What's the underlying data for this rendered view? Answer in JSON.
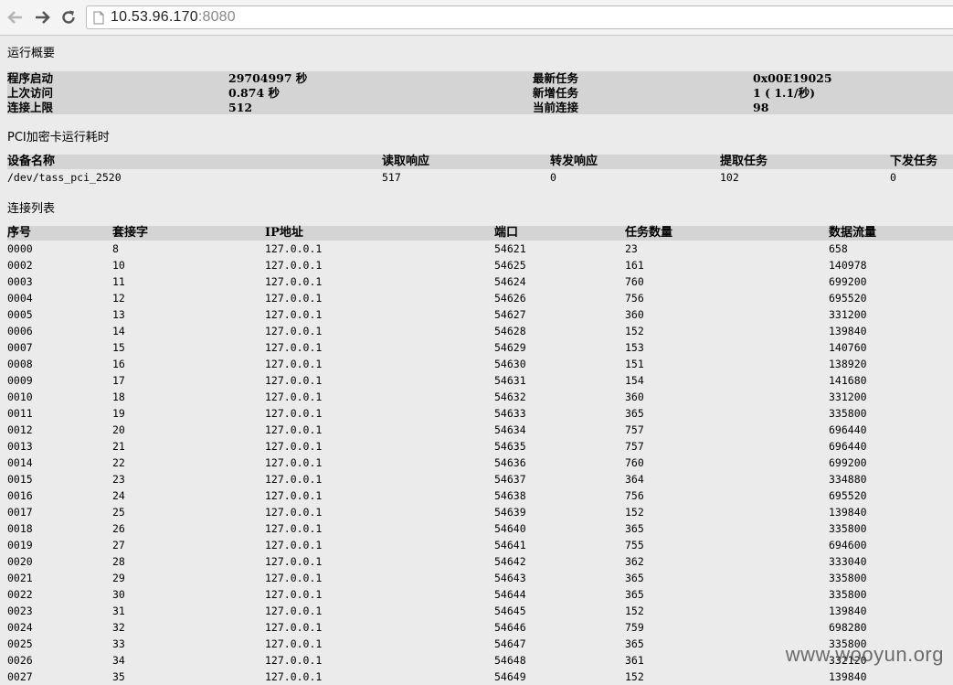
{
  "browser": {
    "url_host": "10.53.96.170",
    "url_port": ":8080"
  },
  "overview": {
    "title": "运行概要",
    "rows": [
      {
        "l1": "程序启动",
        "v1": "29704997 秒",
        "l2": "最新任务",
        "v2": "0x00E19025"
      },
      {
        "l1": "上次访问",
        "v1": "0.874 秒",
        "l2": "新增任务",
        "v2": "1 ( 1.1/秒)"
      },
      {
        "l1": "连接上限",
        "v1": "512",
        "l2": "当前连接",
        "v2": "98"
      }
    ]
  },
  "pci": {
    "title": "PCI加密卡运行耗时",
    "headers": [
      "设备名称",
      "读取响应",
      "转发响应",
      "提取任务",
      "下发任务"
    ],
    "rows": [
      [
        "/dev/tass_pci_2520",
        "517",
        "0",
        "102",
        "0"
      ]
    ]
  },
  "connections": {
    "title": "连接列表",
    "headers": [
      "序号",
      "套接字",
      "IP地址",
      "端口",
      "任务数量",
      "数据流量"
    ],
    "rows": [
      [
        "0000",
        "8",
        "127.0.0.1",
        "54621",
        "23",
        "658"
      ],
      [
        "0002",
        "10",
        "127.0.0.1",
        "54625",
        "161",
        "140978"
      ],
      [
        "0003",
        "11",
        "127.0.0.1",
        "54624",
        "760",
        "699200"
      ],
      [
        "0004",
        "12",
        "127.0.0.1",
        "54626",
        "756",
        "695520"
      ],
      [
        "0005",
        "13",
        "127.0.0.1",
        "54627",
        "360",
        "331200"
      ],
      [
        "0006",
        "14",
        "127.0.0.1",
        "54628",
        "152",
        "139840"
      ],
      [
        "0007",
        "15",
        "127.0.0.1",
        "54629",
        "153",
        "140760"
      ],
      [
        "0008",
        "16",
        "127.0.0.1",
        "54630",
        "151",
        "138920"
      ],
      [
        "0009",
        "17",
        "127.0.0.1",
        "54631",
        "154",
        "141680"
      ],
      [
        "0010",
        "18",
        "127.0.0.1",
        "54632",
        "360",
        "331200"
      ],
      [
        "0011",
        "19",
        "127.0.0.1",
        "54633",
        "365",
        "335800"
      ],
      [
        "0012",
        "20",
        "127.0.0.1",
        "54634",
        "757",
        "696440"
      ],
      [
        "0013",
        "21",
        "127.0.0.1",
        "54635",
        "757",
        "696440"
      ],
      [
        "0014",
        "22",
        "127.0.0.1",
        "54636",
        "760",
        "699200"
      ],
      [
        "0015",
        "23",
        "127.0.0.1",
        "54637",
        "364",
        "334880"
      ],
      [
        "0016",
        "24",
        "127.0.0.1",
        "54638",
        "756",
        "695520"
      ],
      [
        "0017",
        "25",
        "127.0.0.1",
        "54639",
        "152",
        "139840"
      ],
      [
        "0018",
        "26",
        "127.0.0.1",
        "54640",
        "365",
        "335800"
      ],
      [
        "0019",
        "27",
        "127.0.0.1",
        "54641",
        "755",
        "694600"
      ],
      [
        "0020",
        "28",
        "127.0.0.1",
        "54642",
        "362",
        "333040"
      ],
      [
        "0021",
        "29",
        "127.0.0.1",
        "54643",
        "365",
        "335800"
      ],
      [
        "0022",
        "30",
        "127.0.0.1",
        "54644",
        "365",
        "335800"
      ],
      [
        "0023",
        "31",
        "127.0.0.1",
        "54645",
        "152",
        "139840"
      ],
      [
        "0024",
        "32",
        "127.0.0.1",
        "54646",
        "759",
        "698280"
      ],
      [
        "0025",
        "33",
        "127.0.0.1",
        "54647",
        "365",
        "335800"
      ],
      [
        "0026",
        "34",
        "127.0.0.1",
        "54648",
        "361",
        "332120"
      ],
      [
        "0027",
        "35",
        "127.0.0.1",
        "54649",
        "152",
        "139840"
      ]
    ]
  },
  "watermark": "www.wooyun.org"
}
